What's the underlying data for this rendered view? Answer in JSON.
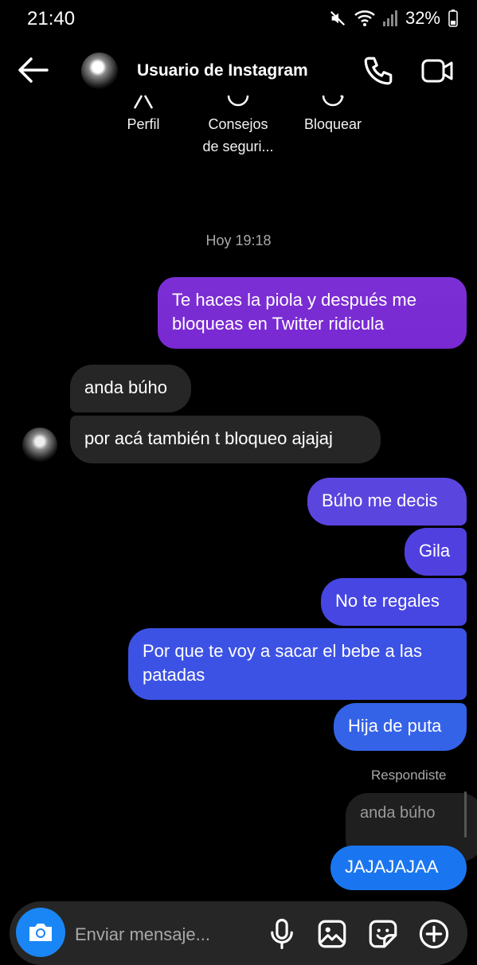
{
  "status_bar": {
    "time": "21:40",
    "battery": "32%",
    "icons": [
      "mute-icon",
      "wifi-icon",
      "signal-icon",
      "battery-icon"
    ]
  },
  "header": {
    "contact_name": "Usuario de Instagram",
    "icons": [
      "back-arrow-icon",
      "phone-icon",
      "video-camera-icon"
    ]
  },
  "profile_actions": [
    {
      "label": "Perfil"
    },
    {
      "label": "Consejos de seguri..."
    },
    {
      "label": "Bloquear"
    }
  ],
  "conversation": {
    "timestamp": "Hoy 19:18",
    "messages": [
      {
        "side": "out",
        "text": "Te haces la piola y después me bloqueas en Twitter ridicula"
      },
      {
        "side": "in",
        "text": "anda búho"
      },
      {
        "side": "in",
        "text": "por acá también t bloqueo ajajaj"
      },
      {
        "side": "out",
        "text": "Búho me decis"
      },
      {
        "side": "out",
        "text": "Gila"
      },
      {
        "side": "out",
        "text": "No te regales"
      },
      {
        "side": "out",
        "text": "Por que te voy a sacar el bebe a las patadas"
      },
      {
        "side": "out",
        "text": "Hija de puta"
      },
      {
        "side": "out",
        "text": "JAJAJAJAA",
        "reply_label": "Respondiste",
        "quoted_text": "anda búho"
      }
    ]
  },
  "composer": {
    "placeholder": "Enviar mensaje...",
    "icons": [
      "camera-icon",
      "microphone-icon",
      "gallery-icon",
      "sticker-icon",
      "plus-icon"
    ]
  },
  "colors": {
    "background": "#000000",
    "incoming_bubble": "#262626",
    "outgoing_gradient_top": "#7b2fd4",
    "outgoing_gradient_bottom": "#1a76f0",
    "camera_button": "#1a86f5"
  }
}
